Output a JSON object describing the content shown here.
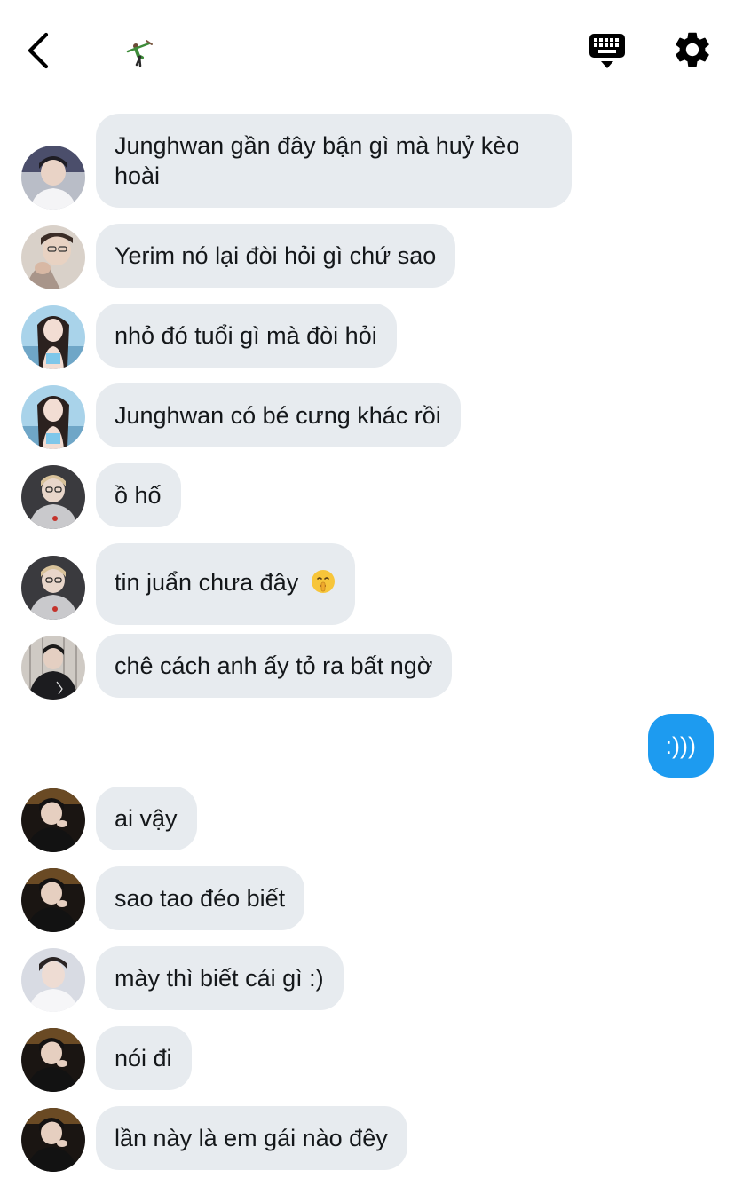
{
  "header": {
    "back_icon": "chevron-left-icon",
    "group_icon": "dancer-sticker-icon",
    "keyboard_icon": "keyboard-hide-icon",
    "settings_icon": "gear-icon"
  },
  "messages": [
    {
      "text": "Junghwan gần đây bận gì mà huỷ kèo hoài",
      "sender": "other"
    },
    {
      "text": "Yerim nó lại đòi hỏi gì chứ sao",
      "sender": "other"
    },
    {
      "text": "nhỏ đó tuổi gì mà đòi hỏi",
      "sender": "other"
    },
    {
      "text": "Junghwan có bé cưng khác rồi",
      "sender": "other"
    },
    {
      "text": "ồ hố",
      "sender": "other"
    },
    {
      "text": "tin juẩn chưa đây",
      "sender": "other",
      "emoji": "shushing-face"
    },
    {
      "text": "chê cách anh ấy tỏ ra bất ngờ",
      "sender": "other"
    },
    {
      "text": ":)))",
      "sender": "me"
    },
    {
      "text": "ai vậy",
      "sender": "other"
    },
    {
      "text": "sao tao đéo biết",
      "sender": "other"
    },
    {
      "text": "mày thì biết cái gì :)",
      "sender": "other"
    },
    {
      "text": "nói đi",
      "sender": "other"
    },
    {
      "text": "lần này là em gái nào đêy",
      "sender": "other"
    }
  ],
  "colors": {
    "incoming_bubble": "#e7ebef",
    "outgoing_bubble": "#1d9bf0",
    "text": "#14171a"
  }
}
